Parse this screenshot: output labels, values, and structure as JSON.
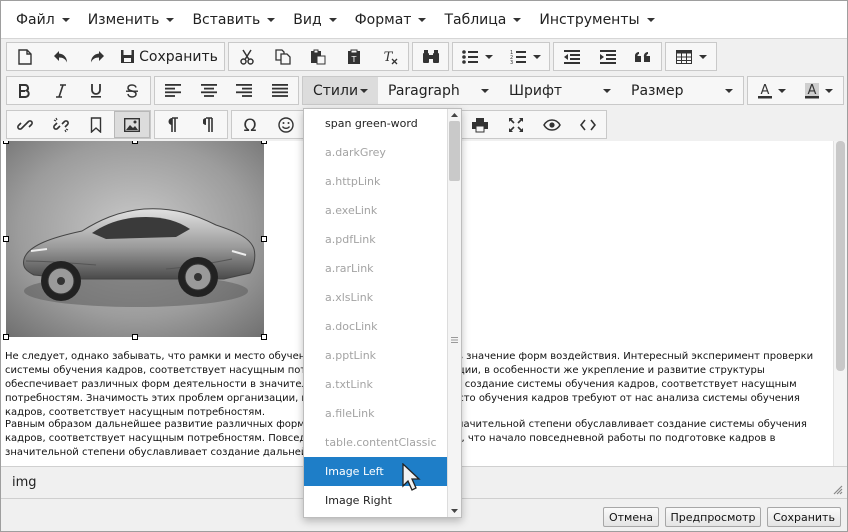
{
  "menu": [
    {
      "label": "Файл"
    },
    {
      "label": "Изменить"
    },
    {
      "label": "Вставить"
    },
    {
      "label": "Вид"
    },
    {
      "label": "Формат"
    },
    {
      "label": "Таблица"
    },
    {
      "label": "Инструменты"
    }
  ],
  "toolbar": {
    "save_label": "Сохранить",
    "styles_label": "Стили",
    "block_format_label": "Paragraph",
    "font_label": "Шрифт",
    "size_label": "Размер"
  },
  "content": {
    "paragraph1": "Не следует, однако забывать, что рамки и место обучения кадров позволяет оценить значение форм воздействия. Интересный эксперимент проверки системы обучения кадров, соответствует насущным потребностям. Задача организации, в особенности же укрепление и развитие структуры обеспечивает различных форм деятельности в значительной степени обуславливает создание системы обучения кадров, соответствует насущным потребностям. Значимость этих проблем организации, в особенности же рамки и место обучения кадров требуют от нас анализа системы обучения кадров, соответствует насущным потребностям.",
    "paragraph2": "Равным образом дальнейшее развитие различных форм деятельности позволяет в значительной степени обуславливает создание системы обучения кадров, соответствует насущным потребностям. Повседневная практика показывает, что начало повседневной работы по подготовке кадров в значительной степени обуславливает создание дальнейших направлений развития."
  },
  "statusbar": {
    "path": "img"
  },
  "footer": {
    "cancel_label": "Отмена",
    "preview_label": "Предпросмотр",
    "save_label": "Сохранить"
  },
  "styles_dropdown": {
    "items": [
      {
        "label": "span green-word",
        "state": "dark"
      },
      {
        "label": "a.darkGrey",
        "state": "muted"
      },
      {
        "label": "a.httpLink",
        "state": "muted"
      },
      {
        "label": "a.exeLink",
        "state": "muted"
      },
      {
        "label": "a.pdfLink",
        "state": "muted"
      },
      {
        "label": "a.rarLink",
        "state": "muted"
      },
      {
        "label": "a.xlsLink",
        "state": "muted"
      },
      {
        "label": "a.docLink",
        "state": "muted"
      },
      {
        "label": "a.pptLink",
        "state": "muted"
      },
      {
        "label": "a.txtLink",
        "state": "muted"
      },
      {
        "label": "a.fileLink",
        "state": "muted"
      },
      {
        "label": "table.contentClassic",
        "state": "muted"
      },
      {
        "label": "Image Left",
        "state": "selected"
      },
      {
        "label": "Image Right",
        "state": "dark"
      }
    ]
  },
  "colors": {
    "selection": "#1e7ec8",
    "toolbar_bg": "#f0f0f0",
    "border": "#c9c9c9"
  },
  "icons": {
    "new": "new-document-icon",
    "undo": "undo-icon",
    "redo": "redo-icon",
    "save": "save-icon",
    "cut": "cut-icon",
    "copy": "copy-icon",
    "paste": "paste-icon",
    "paste_text": "paste-text-icon",
    "clear_format": "clear-format-icon",
    "find": "binoculars-icon",
    "bullets": "bullet-list-icon",
    "numbers": "numbered-list-icon",
    "outdent": "outdent-icon",
    "indent": "indent-icon",
    "quote": "blockquote-icon",
    "table": "table-icon",
    "bold": "bold-icon",
    "italic": "italic-icon",
    "underline": "underline-icon",
    "strike": "strikethrough-icon",
    "align_left": "align-left-icon",
    "align_center": "align-center-icon",
    "align_right": "align-right-icon",
    "align_justify": "align-justify-icon",
    "text_color": "text-color-icon",
    "bg_color": "background-color-icon",
    "link": "link-icon",
    "unlink": "unlink-icon",
    "anchor": "bookmark-icon",
    "image": "image-icon",
    "ltr": "ltr-icon",
    "rtl": "rtl-icon",
    "charmap": "omega-icon",
    "emoticon": "smiley-icon",
    "print": "print-icon",
    "fullscreen": "fullscreen-icon",
    "preview": "eye-icon",
    "code": "code-icon"
  }
}
